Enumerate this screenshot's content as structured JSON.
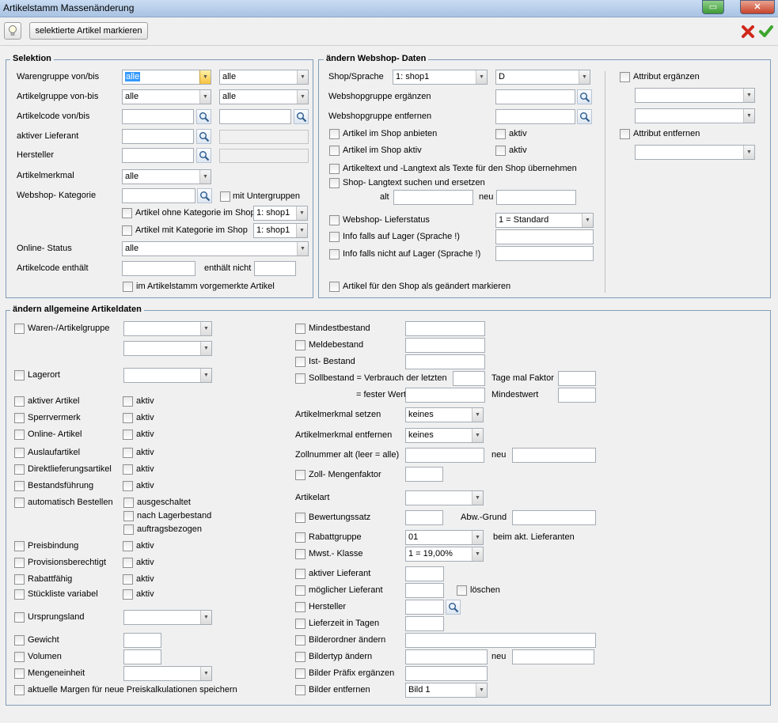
{
  "window": {
    "title": "Artikelstamm Massenänderung",
    "min_glyph": "▭",
    "close_glyph": "✕"
  },
  "toolbar": {
    "mark_button": "selektierte Artikel markieren"
  },
  "selektion": {
    "legend": "Selektion",
    "warengruppe_label": "Warengruppe von/bis",
    "warengruppe_from": "alle",
    "warengruppe_to": "alle",
    "artikelgruppe_label": "Artikelgruppe von-bis",
    "artikelgruppe_from": "alle",
    "artikelgruppe_to": "alle",
    "artikelcode_label": "Artikelcode von/bis",
    "lieferant_label": "aktiver Lieferant",
    "hersteller_label": "Hersteller",
    "merkmal_label": "Artikelmerkmal",
    "merkmal_value": "alle",
    "kategorie_label": "Webshop- Kategorie",
    "untergruppen_label": "mit Untergruppen",
    "ohne_kat_label": "Artikel ohne Kategorie im Shop",
    "ohne_kat_shop": "1: shop1",
    "mit_kat_label": "Artikel mit Kategorie im Shop",
    "mit_kat_shop": "1: shop1",
    "online_label": "Online- Status",
    "online_value": "alle",
    "code_enthaelt_label": "Artikelcode enthält",
    "enthaelt_nicht_label": "enthält nicht",
    "vorgemerkt_label": "im Artikelstamm vorgemerkte Artikel"
  },
  "webshop": {
    "legend": "ändern Webshop- Daten",
    "shop_label": "Shop/Sprache",
    "shop_value": "1: shop1",
    "sprache_value": "D",
    "gruppe_erg_label": "Webshopgruppe ergänzen",
    "gruppe_entf_label": "Webshopgruppe entfernen",
    "anbieten_label": "Artikel im Shop anbieten",
    "aktiv1_label": "aktiv",
    "shop_aktiv_label": "Artikel im Shop aktiv",
    "aktiv2_label": "aktiv",
    "texte_label": "Artikeltext und -Langtext als Texte für den Shop übernehmen",
    "langtext_label": "Shop- Langtext suchen und ersetzen",
    "alt_label": "alt",
    "neu_label": "neu",
    "lieferstatus_label": "Webshop- Lieferstatus",
    "lieferstatus_value": "1 = Standard",
    "info_lager_label": "Info falls auf Lager (Sprache !)",
    "info_nicht_lager_label": "Info falls nicht auf Lager (Sprache !)",
    "geaendert_label": "Artikel für den Shop als geändert markieren",
    "attr_erg_label": "Attribut ergänzen",
    "attr_entf_label": "Attribut entfernen"
  },
  "allgemein": {
    "legend": "ändern allgemeine Artikeldaten",
    "waren_label": "Waren-/Artikelgruppe",
    "lagerort_label": "Lagerort",
    "aktiv": "aktiv",
    "aktiver_artikel": "aktiver Artikel",
    "sperrvermerk": "Sperrvermerk",
    "online_artikel": "Online- Artikel",
    "auslauf": "Auslaufartikel",
    "direkt": "Direktlieferungsartikel",
    "bestand_fuehrung": "Bestandsführung",
    "auto_bestellen": "automatisch Bestellen",
    "ausgeschaltet": "ausgeschaltet",
    "nach_lager": "nach Lagerbestand",
    "auftrag": "auftragsbezogen",
    "preisbindung": "Preisbindung",
    "provision": "Provisionsberechtigt",
    "rabattfaehig": "Rabattfähig",
    "stueckliste": "Stückliste variabel",
    "ursprung": "Ursprungsland",
    "gewicht": "Gewicht",
    "volumen": "Volumen",
    "mengeneinheit": "Mengeneinheit",
    "margen": "aktuelle Margen für neue Preiskalkulationen speichern",
    "mindestbestand": "Mindestbestand",
    "meldebestand": "Meldebestand",
    "ist_bestand": "Ist- Bestand",
    "sollbestand": "Sollbestand = Verbrauch der letzten",
    "tage_faktor": "Tage mal Faktor",
    "fester_wert": "= fester Wert",
    "mindestwert": "Mindestwert",
    "merkmal_setzen": "Artikelmerkmal setzen",
    "merkmal_setzen_value": "keines",
    "merkmal_entf": "Artikelmerkmal entfernen",
    "merkmal_entf_value": "keines",
    "zoll_alt": "Zollnummer alt (leer = alle)",
    "zoll_neu": "neu",
    "zoll_faktor": "Zoll- Mengenfaktor",
    "artikelart": "Artikelart",
    "bewertung": "Bewertungssatz",
    "abw_grund": "Abw.-Grund",
    "rabattgruppe": "Rabattgruppe",
    "rabattgruppe_value": "01",
    "beim_lief": "beim akt. Lieferanten",
    "mwst": "Mwst.- Klasse",
    "mwst_value": "1 = 19,00%",
    "akt_lieferant": "aktiver Lieferant",
    "mogl_lieferant": "möglicher Lieferant",
    "loeschen": "löschen",
    "hersteller": "Hersteller",
    "lieferzeit": "Lieferzeit in Tagen",
    "bilderordner": "Bilderordner ändern",
    "bildertyp": "Bildertyp ändern",
    "bildertyp_neu": "neu",
    "bilder_praefix": "Bilder Präfix ergänzen",
    "bilder_entf": "Bilder entfernen",
    "bilder_entf_value": "Bild 1"
  },
  "colors": {
    "title_bg": "#b9cfea",
    "border": "#7f9db9",
    "highlight": "#3399ff"
  }
}
